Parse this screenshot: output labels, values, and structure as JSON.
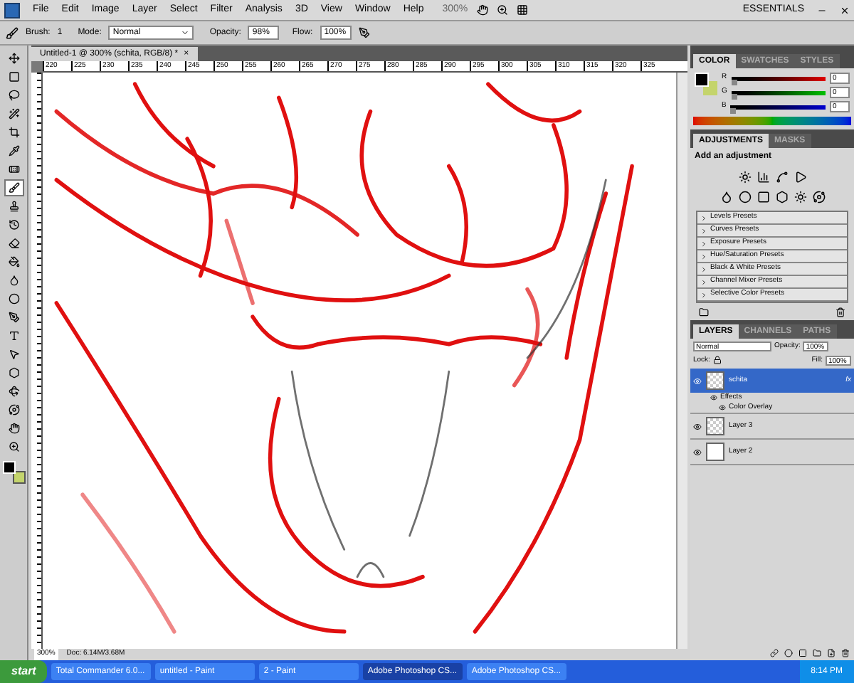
{
  "menu_bar": {
    "items": [
      "File",
      "Edit",
      "Image",
      "Layer",
      "Select",
      "Filter",
      "Analysis",
      "3D",
      "View",
      "Window",
      "Help"
    ],
    "zoom": "300%",
    "workspace": "ESSENTIALS"
  },
  "options_bar": {
    "brush_label": "Brush:",
    "brush_size": "1",
    "mode_label": "Mode:",
    "mode": "Normal",
    "opacity_label": "Opacity:",
    "opacity": "98%",
    "flow_label": "Flow:",
    "flow": "100%"
  },
  "tools": [
    {
      "kind": "move",
      "selected": false
    },
    {
      "kind": "marquee",
      "selected": false
    },
    {
      "kind": "lasso",
      "selected": false
    },
    {
      "kind": "wand",
      "selected": false
    },
    {
      "kind": "crop",
      "selected": false
    },
    {
      "kind": "eyedropper",
      "selected": false
    },
    {
      "kind": "heal",
      "selected": false
    },
    {
      "kind": "brush",
      "selected": true
    },
    {
      "kind": "stamp",
      "selected": false
    },
    {
      "kind": "history",
      "selected": false
    },
    {
      "kind": "eraser",
      "selected": false
    },
    {
      "kind": "bucket",
      "selected": false
    },
    {
      "kind": "blur",
      "selected": false
    },
    {
      "kind": "dodge",
      "selected": false
    },
    {
      "kind": "pen",
      "selected": false
    },
    {
      "kind": "type",
      "selected": false
    },
    {
      "kind": "path",
      "selected": false
    },
    {
      "kind": "shape",
      "selected": false
    },
    {
      "kind": "rotate3d",
      "selected": false
    },
    {
      "kind": "orbit",
      "selected": false
    },
    {
      "kind": "hand",
      "selected": false
    },
    {
      "kind": "zoom",
      "selected": false
    }
  ],
  "swatches": [
    {
      "color": "#000000"
    },
    {
      "color": "#c4d46c"
    }
  ],
  "document": {
    "tab": "Untitled-1 @ 300% (schita, RGB/8) *",
    "close": "×",
    "ruler": [
      "220",
      "225",
      "230",
      "235",
      "240",
      "245",
      "250",
      "255",
      "260",
      "265",
      "270",
      "275",
      "280",
      "285",
      "290",
      "295",
      "300",
      "305",
      "310",
      "315",
      "320",
      "325"
    ]
  },
  "status_bar": {
    "zoom": "300%",
    "doc": "Doc: 6.14M/3.68M"
  },
  "color_panel": {
    "tabs": [
      {
        "label": "COLOR",
        "selected": true
      },
      {
        "label": "SWATCHES",
        "selected": false
      },
      {
        "label": "STYLES",
        "selected": false
      }
    ],
    "channels": [
      {
        "name": "R",
        "value": "0",
        "level": 0
      },
      {
        "name": "G",
        "value": "0",
        "level": 0
      },
      {
        "name": "B",
        "value": "0",
        "level": 0
      }
    ]
  },
  "adjustments_panel": {
    "tabs": [
      {
        "label": "ADJUSTMENTS",
        "selected": true
      },
      {
        "label": "MASKS",
        "selected": false
      }
    ],
    "heading": "Add an adjustment",
    "presets": [
      "Levels Presets",
      "Curves Presets",
      "Exposure Presets",
      "Hue/Saturation Presets",
      "Black & White Presets",
      "Channel Mixer Presets",
      "Selective Color Presets"
    ]
  },
  "layers_panel": {
    "tabs": [
      {
        "label": "LAYERS",
        "selected": true
      },
      {
        "label": "CHANNELS",
        "selected": false
      },
      {
        "label": "PATHS",
        "selected": false
      }
    ],
    "blend_mode": "Normal",
    "opacity_label": "Opacity:",
    "opacity": "100%",
    "lock_label": "Lock:",
    "fill_label": "Fill:",
    "fill": "100%",
    "layers": [
      {
        "name": "schita",
        "selected": true,
        "visible": true,
        "transparent": true,
        "fx": "fx",
        "effects_label": "Effects",
        "effects": [
          "Color Overlay"
        ]
      },
      {
        "name": "Layer 3",
        "selected": false,
        "visible": true,
        "transparent": true
      },
      {
        "name": "Layer 2",
        "selected": false,
        "visible": true,
        "transparent": false
      }
    ]
  },
  "taskbar": {
    "start": "start",
    "tasks": [
      {
        "label": "Total Commander 6.0...",
        "selected": false
      },
      {
        "label": "untitled - Paint",
        "selected": false
      },
      {
        "label": "2 - Paint",
        "selected": false
      },
      {
        "label": "Adobe Photoshop CS...",
        "selected": true
      },
      {
        "label": "Adobe Photoshop CS...",
        "selected": false
      }
    ],
    "time": "8:14 PM"
  }
}
